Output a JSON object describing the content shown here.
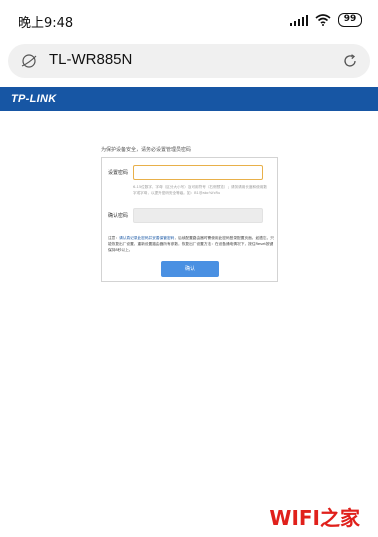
{
  "status_bar": {
    "time": "晚上9:48",
    "battery": "99"
  },
  "browser": {
    "url": "TL-WR885N"
  },
  "router": {
    "brand": "TP-LINK",
    "intro": "为保护设备安全，请务必设置管理员密码",
    "password_label": "设置密码",
    "password_value": "",
    "password_hint": "6-15位数字、字母（区分大小写）及可用符号（右侧预览）；请务请用长度和使用数字或字母，以提升密码安全等级。如：B1@abc%fcRu",
    "confirm_label": "确认密码",
    "note_prefix": "注意：",
    "note_link": "请认真记录此密码并妥善保管密码",
    "note_rest": "，后续配置路由器时需使用此密码登录配置页面。如遗忘，只能恢复出厂设置，重新设置路由器所有参数，恢复出厂设置方法：在设备通电情况下，按住Reset按键保持8秒以上。",
    "confirm_button": "确认"
  },
  "watermark": "WIFI之家",
  "colors": {
    "brand_blue": "#1756a4",
    "button_blue": "#4a90e2",
    "input_focus": "#e8b04a",
    "watermark_red": "#e0201b"
  }
}
